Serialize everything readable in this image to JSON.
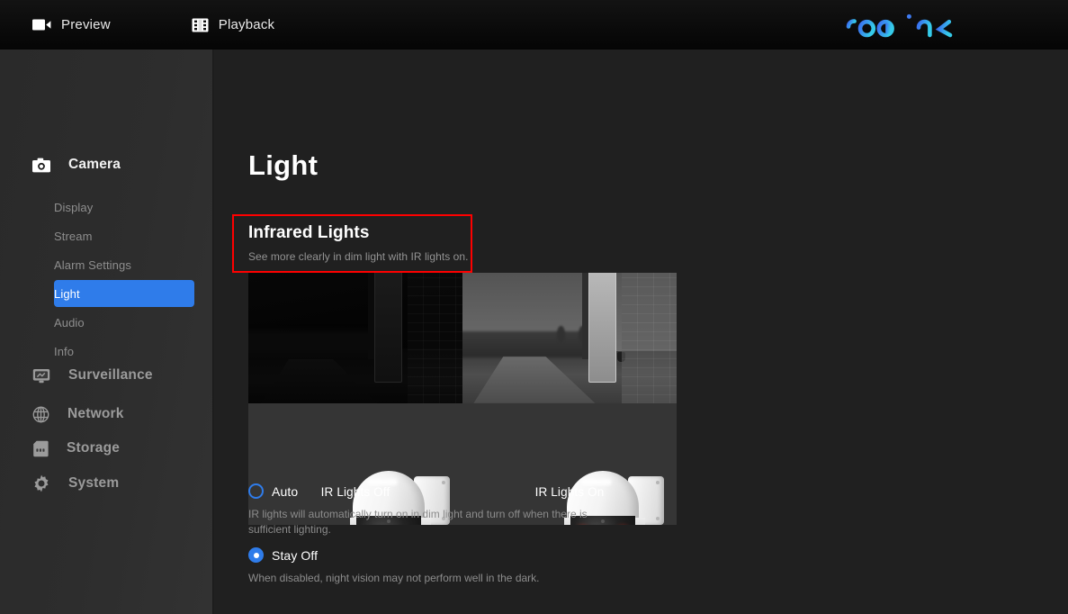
{
  "topbar": {
    "nav": [
      {
        "label": "Preview",
        "icon": "video-camera-icon"
      },
      {
        "label": "Playback",
        "icon": "film-strip-icon"
      }
    ],
    "logo": {
      "text": "reolink",
      "color_start": "#3b6ff2",
      "color_end": "#33c9e8"
    }
  },
  "sidebar": {
    "groups": [
      {
        "label": "Camera",
        "icon": "photo-camera-icon",
        "active": true,
        "items": [
          {
            "label": "Display",
            "active": false
          },
          {
            "label": "Stream",
            "active": false
          },
          {
            "label": "Alarm Settings",
            "active": false
          },
          {
            "label": "Light",
            "active": true
          },
          {
            "label": "Audio",
            "active": false
          },
          {
            "label": "Info",
            "active": false
          }
        ]
      },
      {
        "label": "Surveillance",
        "icon": "monitor-icon",
        "active": false,
        "items": []
      },
      {
        "label": "Network",
        "icon": "globe-icon",
        "active": false,
        "items": []
      },
      {
        "label": "Storage",
        "icon": "sd-card-icon",
        "active": false,
        "items": []
      },
      {
        "label": "System",
        "icon": "gear-icon",
        "active": false,
        "items": []
      }
    ],
    "active_item": "Light",
    "active_color": "#2f7cea"
  },
  "main": {
    "page_title": "Light",
    "section": {
      "title": "Infrared Lights",
      "description": "See more clearly in dim light with IR lights on.",
      "highlight_color": "#fe0000",
      "highlighted": true
    },
    "comparison": {
      "left": {
        "caption": "IR Lights Off",
        "state": "off"
      },
      "right": {
        "caption": "IR Lights On",
        "state": "on"
      }
    },
    "options": [
      {
        "label": "Auto",
        "selected": false,
        "description": "IR lights will automatically turn on in dim light and turn off when there is sufficient lighting."
      },
      {
        "label": "Stay Off",
        "selected": true,
        "description": "When disabled, night vision may not perform well in the dark."
      }
    ]
  }
}
